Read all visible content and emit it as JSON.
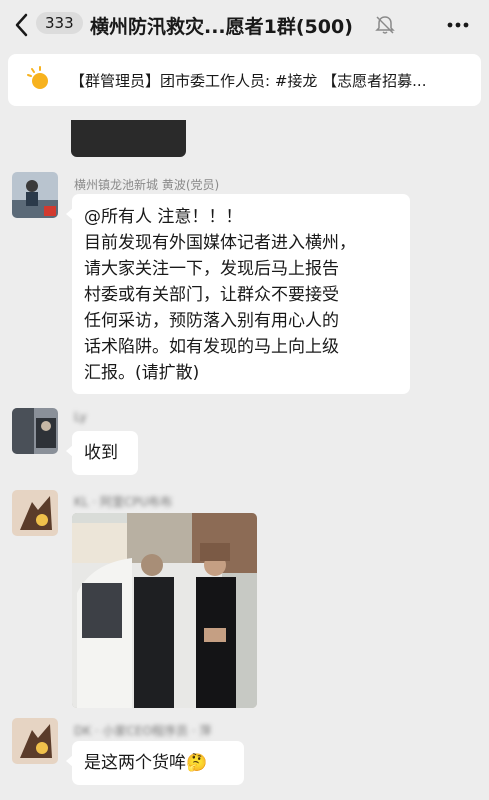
{
  "header": {
    "unread_count": "333",
    "title": "横州防汛救灾...愿者1群(500)"
  },
  "announcement": {
    "text": "【群管理员】团市委工作人员: #接龙 【志愿者招募..."
  },
  "messages": [
    {
      "sender": "横州镇龙池新城 黄波(党员)",
      "lines": [
        "@所有人  注意！！！",
        "目前发现有外国媒体记者进入横州，",
        "请大家关注一下，发现后马上报告",
        "村委或有关部门，让群众不要接受",
        "任何采访，预防落入别有用心人的",
        "话术陷阱。如有发现的马上向上级",
        "汇报。(请扩散)"
      ]
    },
    {
      "sender": "Ly",
      "text": "收到"
    },
    {
      "sender": "KL · 阿里CPU布布",
      "type": "image"
    },
    {
      "sender": "DK · 小家CEO程序员 · 萍",
      "text": "是这两个货哞🤔"
    }
  ],
  "icons": {
    "back": "chevron-left-icon",
    "mute": "bell-off-icon",
    "more": "more-dots-icon",
    "announce": "sun-icon"
  }
}
